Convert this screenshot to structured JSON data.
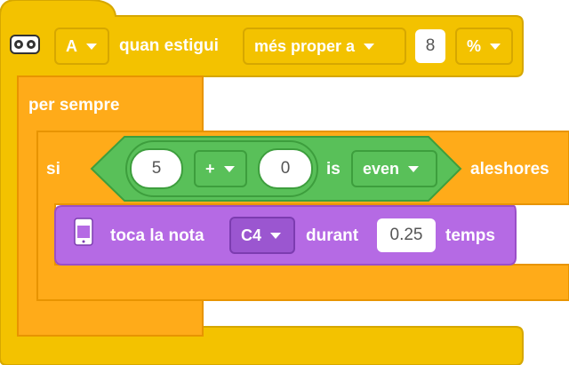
{
  "hat_block": {
    "sensor_icon": "distance-sensor-icon",
    "port": "A",
    "label": "quan estigui",
    "comparison": "més proper a",
    "value": "8",
    "unit": "%"
  },
  "forever_block": {
    "label": "per sempre"
  },
  "if_block": {
    "if_label": "si",
    "then_label": "aleshores",
    "condition": {
      "left": "5",
      "operator": "+",
      "right": "0",
      "is_label": "is",
      "parity": "even"
    }
  },
  "play_note_block": {
    "hub_icon": "hub-icon",
    "label": "toca la nota",
    "note": "C4",
    "for_label": "durant",
    "duration": "0.25",
    "unit_label": "temps"
  },
  "colors": {
    "event": "#f3c200",
    "control": "#ffab19",
    "operator": "#59c059",
    "sound": "#b56ae4"
  }
}
